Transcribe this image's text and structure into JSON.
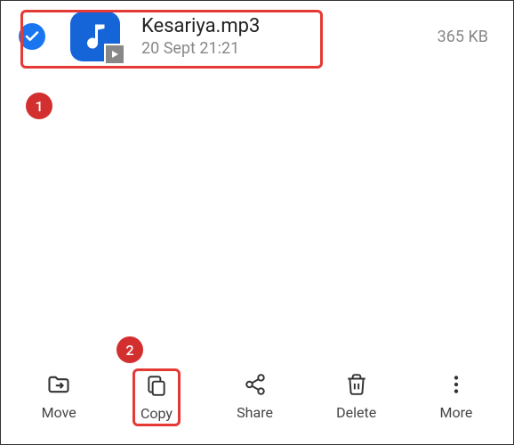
{
  "file": {
    "name": "Kesariya.mp3",
    "date": "20 Sept 21:21",
    "size": "365 KB",
    "selected": true
  },
  "actions": {
    "move": "Move",
    "copy": "Copy",
    "share": "Share",
    "delete": "Delete",
    "more": "More"
  },
  "annotations": {
    "badge1": "1",
    "badge2": "2"
  }
}
